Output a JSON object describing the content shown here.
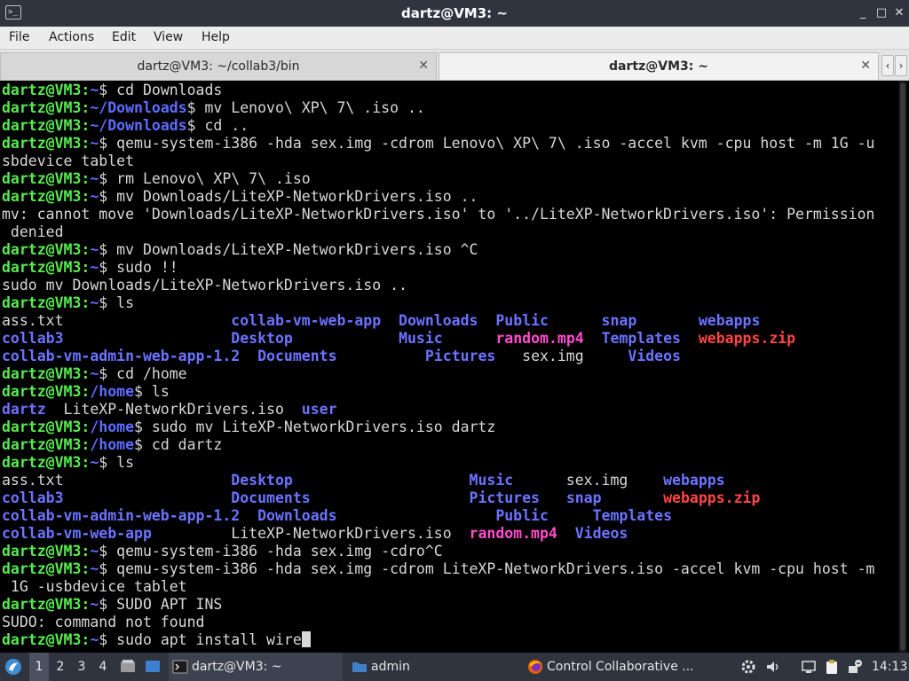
{
  "window": {
    "title": "dartz@VM3: ~",
    "app_icon_glyph": ">_",
    "minimize_glyph": "_",
    "maximize_glyph": "□",
    "close_glyph": "✕"
  },
  "menu": [
    "File",
    "Actions",
    "Edit",
    "View",
    "Help"
  ],
  "tabs": [
    {
      "label": "dartz@VM3: ~/collab3/bin",
      "close_glyph": "✕"
    },
    {
      "label": "dartz@VM3: ~",
      "close_glyph": "✕"
    }
  ],
  "tab_arrows": {
    "left": "‹",
    "right": "›"
  },
  "colors": {
    "prompt_user": "#56e94f",
    "prompt_path": "#5c6cff",
    "directory": "#6b73ff",
    "media_file": "#ff4ccd",
    "archive_file": "#ff4444",
    "text": "#d8d8d8",
    "background": "#000000"
  },
  "terminal": {
    "lines": [
      [
        [
          "u",
          "dartz@VM3:"
        ],
        [
          "p",
          "~"
        ],
        [
          "n",
          "$ cd Downloads"
        ]
      ],
      [
        [
          "u",
          "dartz@VM3:"
        ],
        [
          "p",
          "~/Downloads"
        ],
        [
          "n",
          "$ mv Lenovo\\ XP\\ 7\\ .iso .."
        ]
      ],
      [
        [
          "u",
          "dartz@VM3:"
        ],
        [
          "p",
          "~/Downloads"
        ],
        [
          "n",
          "$ cd .."
        ]
      ],
      [
        [
          "u",
          "dartz@VM3:"
        ],
        [
          "p",
          "~"
        ],
        [
          "n",
          "$ qemu-system-i386 -hda sex.img -cdrom Lenovo\\ XP\\ 7\\ .iso -accel kvm -cpu host -m 1G -u"
        ]
      ],
      [
        [
          "n",
          "sbdevice tablet"
        ]
      ],
      [
        [
          "u",
          "dartz@VM3:"
        ],
        [
          "p",
          "~"
        ],
        [
          "n",
          "$ rm Lenovo\\ XP\\ 7\\ .iso"
        ]
      ],
      [
        [
          "u",
          "dartz@VM3:"
        ],
        [
          "p",
          "~"
        ],
        [
          "n",
          "$ mv Downloads/LiteXP-NetworkDrivers.iso .."
        ]
      ],
      [
        [
          "n",
          "mv: cannot move 'Downloads/LiteXP-NetworkDrivers.iso' to '../LiteXP-NetworkDrivers.iso': Permission"
        ]
      ],
      [
        [
          "n",
          " denied"
        ]
      ],
      [
        [
          "u",
          "dartz@VM3:"
        ],
        [
          "p",
          "~"
        ],
        [
          "n",
          "$ mv Downloads/LiteXP-NetworkDrivers.iso ^C"
        ]
      ],
      [
        [
          "u",
          "dartz@VM3:"
        ],
        [
          "p",
          "~"
        ],
        [
          "n",
          "$ sudo !!"
        ]
      ],
      [
        [
          "n",
          "sudo mv Downloads/LiteXP-NetworkDrivers.iso .."
        ]
      ],
      [
        [
          "u",
          "dartz@VM3:"
        ],
        [
          "p",
          "~"
        ],
        [
          "n",
          "$ ls"
        ]
      ],
      [
        [
          "n",
          "ass.txt                   "
        ],
        [
          "d",
          "collab-vm-web-app"
        ],
        [
          "n",
          "  "
        ],
        [
          "d",
          "Downloads"
        ],
        [
          "n",
          "  "
        ],
        [
          "d",
          "Public"
        ],
        [
          "n",
          "      "
        ],
        [
          "d",
          "snap"
        ],
        [
          "n",
          "       "
        ],
        [
          "d",
          "webapps"
        ]
      ],
      [
        [
          "d",
          "collab3"
        ],
        [
          "n",
          "                   "
        ],
        [
          "d",
          "Desktop"
        ],
        [
          "n",
          "            "
        ],
        [
          "d",
          "Music"
        ],
        [
          "n",
          "      "
        ],
        [
          "m",
          "random.mp4"
        ],
        [
          "n",
          "  "
        ],
        [
          "d",
          "Templates"
        ],
        [
          "n",
          "  "
        ],
        [
          "z",
          "webapps.zip"
        ]
      ],
      [
        [
          "d",
          "collab-vm-admin-web-app-1.2"
        ],
        [
          "n",
          "  "
        ],
        [
          "d",
          "Documents"
        ],
        [
          "n",
          "          "
        ],
        [
          "d",
          "Pictures"
        ],
        [
          "n",
          "   sex.img     "
        ],
        [
          "d",
          "Videos"
        ]
      ],
      [
        [
          "u",
          "dartz@VM3:"
        ],
        [
          "p",
          "~"
        ],
        [
          "n",
          "$ cd /home"
        ]
      ],
      [
        [
          "u",
          "dartz@VM3:"
        ],
        [
          "p",
          "/home"
        ],
        [
          "n",
          "$ ls"
        ]
      ],
      [
        [
          "d",
          "dartz"
        ],
        [
          "n",
          "  LiteXP-NetworkDrivers.iso  "
        ],
        [
          "d",
          "user"
        ]
      ],
      [
        [
          "u",
          "dartz@VM3:"
        ],
        [
          "p",
          "/home"
        ],
        [
          "n",
          "$ sudo mv LiteXP-NetworkDrivers.iso dartz"
        ]
      ],
      [
        [
          "u",
          "dartz@VM3:"
        ],
        [
          "p",
          "/home"
        ],
        [
          "n",
          "$ cd dartz"
        ]
      ],
      [
        [
          "u",
          "dartz@VM3:"
        ],
        [
          "p",
          "~"
        ],
        [
          "n",
          "$ ls"
        ]
      ],
      [
        [
          "n",
          "ass.txt                   "
        ],
        [
          "d",
          "Desktop"
        ],
        [
          "n",
          "                    "
        ],
        [
          "d",
          "Music"
        ],
        [
          "n",
          "      sex.img    "
        ],
        [
          "d",
          "webapps"
        ]
      ],
      [
        [
          "d",
          "collab3"
        ],
        [
          "n",
          "                   "
        ],
        [
          "d",
          "Documents"
        ],
        [
          "n",
          "                  "
        ],
        [
          "d",
          "Pictures"
        ],
        [
          "n",
          "   "
        ],
        [
          "d",
          "snap"
        ],
        [
          "n",
          "       "
        ],
        [
          "z",
          "webapps.zip"
        ]
      ],
      [
        [
          "d",
          "collab-vm-admin-web-app-1.2"
        ],
        [
          "n",
          "  "
        ],
        [
          "d",
          "Downloads"
        ],
        [
          "n",
          "                  "
        ],
        [
          "d",
          "Public"
        ],
        [
          "n",
          "     "
        ],
        [
          "d",
          "Templates"
        ]
      ],
      [
        [
          "d",
          "collab-vm-web-app"
        ],
        [
          "n",
          "         LiteXP-NetworkDrivers.iso  "
        ],
        [
          "m",
          "random.mp4"
        ],
        [
          "n",
          "  "
        ],
        [
          "d",
          "Videos"
        ]
      ],
      [
        [
          "u",
          "dartz@VM3:"
        ],
        [
          "p",
          "~"
        ],
        [
          "n",
          "$ qemu-system-i386 -hda sex.img -cdro^C"
        ]
      ],
      [
        [
          "u",
          "dartz@VM3:"
        ],
        [
          "p",
          "~"
        ],
        [
          "n",
          "$ qemu-system-i386 -hda sex.img -cdrom LiteXP-NetworkDrivers.iso -accel kvm -cpu host -m"
        ]
      ],
      [
        [
          "n",
          " 1G -usbdevice tablet"
        ]
      ],
      [
        [
          "u",
          "dartz@VM3:"
        ],
        [
          "p",
          "~"
        ],
        [
          "n",
          "$ SUDO APT INS"
        ]
      ],
      [
        [
          "n",
          "SUDO: command not found"
        ]
      ],
      [
        [
          "u",
          "dartz@VM3:"
        ],
        [
          "p",
          "~"
        ],
        [
          "n",
          "$ sudo apt install wire"
        ]
      ]
    ]
  },
  "taskbar": {
    "workspaces": [
      "1",
      "2",
      "3",
      "4"
    ],
    "tasks": [
      {
        "label": "dartz@VM3: ~"
      },
      {
        "label": "admin"
      },
      {
        "label": "Control Collaborative ..."
      }
    ],
    "clock": "14:13"
  }
}
